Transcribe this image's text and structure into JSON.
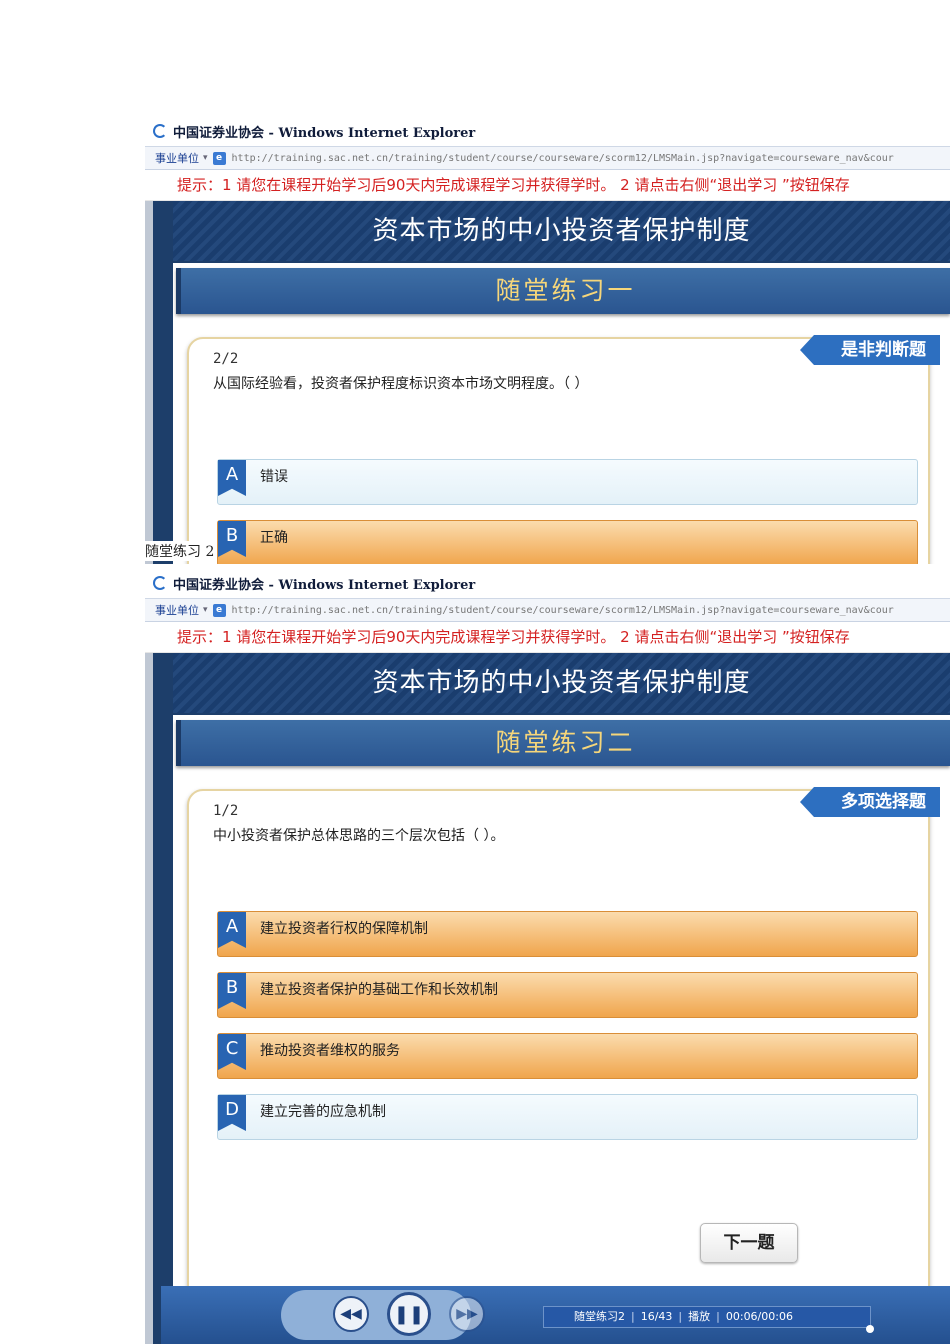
{
  "caption": "随堂练习 2",
  "screenshots": [
    {
      "window_title": "中国证券业协会 - Windows Internet Explorer",
      "favorites_label": "事业单位",
      "dropdown_arrow": "▾",
      "address_url": "http://training.sac.net.cn/training/student/course/courseware/scorm12/LMSMain.jsp?navigate=courseware_nav&cour",
      "notice": "提示：1 请您在课程开始学习后90天内完成课程学习并获得学时。 2 请点击右侧“退出学习 ”按钮保存",
      "course_title": "资本市场的中小投资者保护制度",
      "exercise_title": "随堂练习一",
      "question_type": "是非判断题",
      "question_number": "2/2",
      "question_text": "从国际经验看，投资者保护程度标识资本市场文明程度。（   ）",
      "options": [
        {
          "letter": "A",
          "text": "错误",
          "selected": false
        },
        {
          "letter": "B",
          "text": "正确",
          "selected": true
        }
      ]
    },
    {
      "window_title": "中国证券业协会 - Windows Internet Explorer",
      "favorites_label": "事业单位",
      "dropdown_arrow": "▾",
      "address_url": "http://training.sac.net.cn/training/student/course/courseware/scorm12/LMSMain.jsp?navigate=courseware_nav&cour",
      "notice": "提示：1 请您在课程开始学习后90天内完成课程学习并获得学时。 2 请点击右侧“退出学习 ”按钮保存",
      "course_title": "资本市场的中小投资者保护制度",
      "exercise_title": "随堂练习二",
      "question_type": "多项选择题",
      "question_number": "1/2",
      "question_text": "中小投资者保护总体思路的三个层次包括（   ）。",
      "options": [
        {
          "letter": "A",
          "text": "建立投资者行权的保障机制",
          "selected": true
        },
        {
          "letter": "B",
          "text": "建立投资者保护的基础工作和长效机制",
          "selected": true
        },
        {
          "letter": "C",
          "text": "推动投资者维权的服务",
          "selected": true
        },
        {
          "letter": "D",
          "text": "建立完善的应急机制",
          "selected": false
        }
      ],
      "next_button": "下一题",
      "player": {
        "rewind_glyph": "◀◀",
        "pause_glyph": "❚❚",
        "forward_glyph": "▶▶",
        "chapter": "随堂练习2",
        "page": "16/43",
        "state": "播放",
        "time": "00:06/00:06"
      }
    }
  ]
}
